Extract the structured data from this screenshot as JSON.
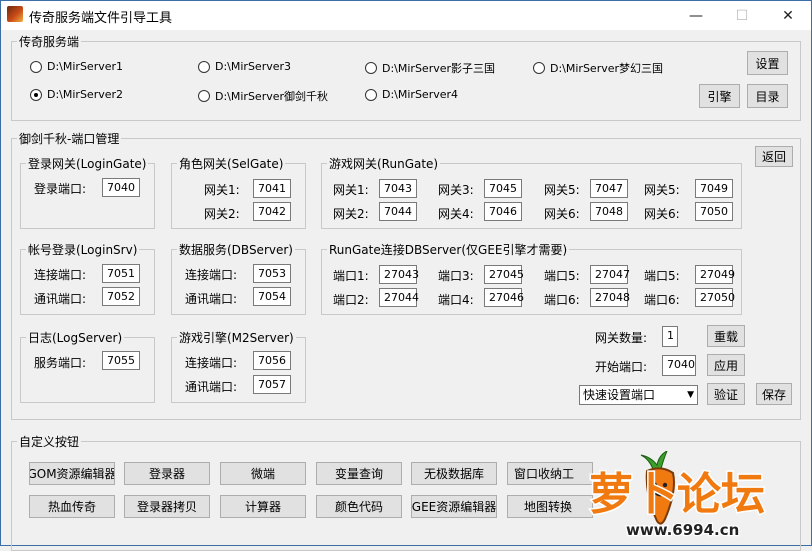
{
  "window": {
    "title": "传奇服务端文件引导工具",
    "minimize": "—",
    "maximize": "☐",
    "close": "✕"
  },
  "servers": {
    "label": "传奇服务端",
    "items": [
      {
        "label": "D:\\MirServer1",
        "checked": false
      },
      {
        "label": "D:\\MirServer3",
        "checked": false
      },
      {
        "label": "D:\\MirServer影子三国",
        "checked": false
      },
      {
        "label": "D:\\MirServer梦幻三国",
        "checked": false
      },
      {
        "label": "D:\\MirServer2",
        "checked": true
      },
      {
        "label": "D:\\MirServer御剑千秋",
        "checked": false
      },
      {
        "label": "D:\\MirServer4",
        "checked": false
      }
    ],
    "settings": "设置",
    "engine": "引擎",
    "directory": "目录"
  },
  "ports": {
    "label": "御剑千秋-端口管理",
    "back": "返回",
    "login_gate": {
      "label": "登录网关(LoginGate)",
      "port_label": "登录端口:",
      "port": "7040"
    },
    "sel_gate": {
      "label": "角色网关(SelGate)",
      "r1_label": "网关1:",
      "r1": "7041",
      "r2_label": "网关2:",
      "r2": "7042"
    },
    "run_gate": {
      "label": "游戏网关(RunGate)",
      "cells": [
        {
          "label": "网关1:",
          "value": "7043"
        },
        {
          "label": "网关3:",
          "value": "7045"
        },
        {
          "label": "网关5:",
          "value": "7047"
        },
        {
          "label": "网关5:",
          "value": "7049"
        },
        {
          "label": "网关2:",
          "value": "7044"
        },
        {
          "label": "网关4:",
          "value": "7046"
        },
        {
          "label": "网关6:",
          "value": "7048"
        },
        {
          "label": "网关6:",
          "value": "7050"
        }
      ]
    },
    "login_srv": {
      "label": "帐号登录(LoginSrv)",
      "connect_label": "连接端口:",
      "connect": "7051",
      "comm_label": "通讯端口:",
      "comm": "7052"
    },
    "db_server": {
      "label": "数据服务(DBServer)",
      "connect_label": "连接端口:",
      "connect": "7053",
      "comm_label": "通讯端口:",
      "comm": "7054"
    },
    "rungate_db": {
      "label": "RunGate连接DBServer(仅GEE引擎才需要)",
      "cells": [
        {
          "label": "端口1:",
          "value": "27043"
        },
        {
          "label": "端口3:",
          "value": "27045"
        },
        {
          "label": "端口5:",
          "value": "27047"
        },
        {
          "label": "端口5:",
          "value": "27049"
        },
        {
          "label": "端口2:",
          "value": "27044"
        },
        {
          "label": "端口4:",
          "value": "27046"
        },
        {
          "label": "端口6:",
          "value": "27048"
        },
        {
          "label": "端口6:",
          "value": "27050"
        }
      ]
    },
    "log_server": {
      "label": "日志(LogServer)",
      "service_label": "服务端口:",
      "service": "7055"
    },
    "m2_server": {
      "label": "游戏引擎(M2Server)",
      "connect_label": "连接端口:",
      "connect": "7056",
      "comm_label": "通讯端口:",
      "comm": "7057"
    },
    "gate_count_label": "网关数量:",
    "gate_count": "1",
    "reload": "重载",
    "start_port_label": "开始端口:",
    "start_port": "7040",
    "apply": "应用",
    "quick_select": "快速设置端口",
    "verify": "验证",
    "save": "保存"
  },
  "custom": {
    "label": "自定义按钮",
    "buttons": [
      "GOM资源编辑器",
      "登录器",
      "微端",
      "变量查询",
      "无极数据库",
      "窗口收纳工",
      "热血传奇",
      "登录器拷贝",
      "计算器",
      "颜色代码",
      "GEE资源编辑器",
      "地图转换"
    ]
  },
  "watermark": {
    "text": "萝卜论坛",
    "url": "www.6994.cn",
    "colors": {
      "orange": "#f07a10",
      "green": "#3aa02a",
      "dark": "#222222"
    }
  }
}
